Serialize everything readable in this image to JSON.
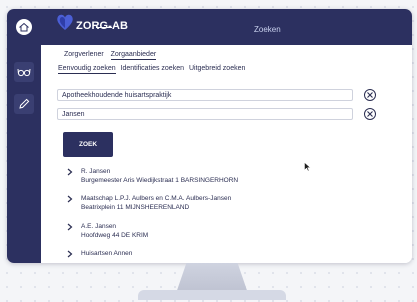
{
  "app": {
    "logo_text": "ZORG-AB",
    "top_title": "Zoeken"
  },
  "icons": {
    "home": "home-icon",
    "glasses": "glasses-icon",
    "pencil": "pencil-icon",
    "logo": "heart-logo-icon",
    "clear": "close-icon",
    "chevron": "chevron-right-icon",
    "cursor": "mouse-cursor-icon"
  },
  "colors": {
    "primary": "#2c3060",
    "text": "#2b2e52",
    "background": "#f4f5f8"
  },
  "tabs_primary": [
    "Zorgverlener",
    "Zorgaanbieder"
  ],
  "tabs_primary_active": "Zorgaanbieder",
  "tabs_secondary": [
    "Eenvoudig zoeken",
    "Identificaties zoeken",
    "Uitgebreid zoeken"
  ],
  "tabs_secondary_active": "Eenvoudig zoeken",
  "search": {
    "field1_value": "Apotheekhoudende huisartspraktijk",
    "field2_value": "Jansen",
    "button_label": "ZOEK"
  },
  "results": [
    {
      "name": "R. Jansen",
      "address": "Burgemeester Aris Wiedijkstraat 1 BARSINGERHORN"
    },
    {
      "name": "Maatschap L.P.J. Aulbers en C.M.A. Aulbers-Jansen",
      "address": "Beatrixplein 11 MIJNSHEERENLAND"
    },
    {
      "name": "A.E. Jansen",
      "address": "Hoofdweg 44 DE KRIM"
    },
    {
      "name": "Huisartsen Annen",
      "address": ""
    }
  ]
}
